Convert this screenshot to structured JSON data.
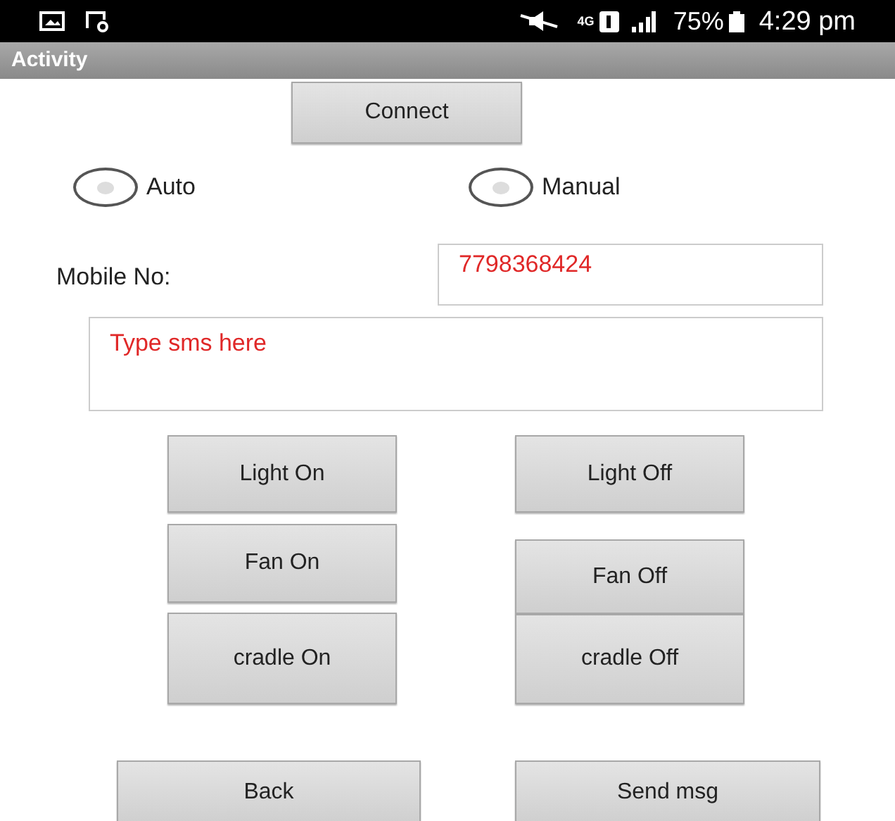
{
  "status_bar": {
    "network": "4G",
    "battery": "75%",
    "time": "4:29 pm"
  },
  "action_bar": {
    "title": "Activity"
  },
  "connect_button": "Connect",
  "modes": [
    {
      "label": "Auto",
      "selected": false
    },
    {
      "label": "Manual",
      "selected": false
    }
  ],
  "mobile": {
    "label": "Mobile No:",
    "value": "7798368424"
  },
  "sms": {
    "placeholder": "Type sms here"
  },
  "left_buttons": [
    "Light On",
    "Fan On",
    "cradle On"
  ],
  "right_buttons": [
    "Light Off",
    "Fan Off",
    "cradle Off"
  ],
  "bottom_buttons": [
    "Back",
    "Send msg"
  ]
}
